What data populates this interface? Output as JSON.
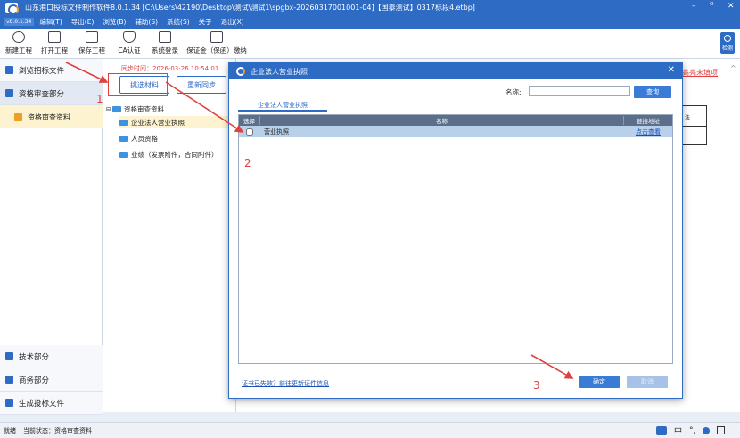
{
  "window": {
    "title": "山东港口投标文件制作软件8.0.1.34    [C:\\Users\\42190\\Desktop\\测试\\测试1\\spgbx-20260317001001-04]【国泰测试】0317标段4.etbp]",
    "controls": [
      "–",
      "ᴼ",
      "✕"
    ]
  },
  "menu": {
    "version_tag": "v8.0.1.34",
    "items": [
      "编辑(T)",
      "导出(E)",
      "浏览(B)",
      "辅助(S)",
      "系统(S)",
      "关于",
      "退出(X)"
    ]
  },
  "toolbar": {
    "buttons": [
      "新建工程",
      "打开工程",
      "保存工程",
      "CA认证",
      "系统登录",
      "保证金（保函）缴纳"
    ],
    "detect_label": "检测"
  },
  "left_nav": {
    "items": [
      "浏览招标文件",
      "资格审查部分"
    ],
    "sub_item": "资格审查资料",
    "bottom_items": [
      "技术部分",
      "商务部分",
      "生成投标文件"
    ]
  },
  "middle": {
    "sync_time_label": "同步时间：2026-03-26 10:54:01",
    "select_button": "挑选材料",
    "resync_button": "重新同步",
    "tree_root": "资格审查资料",
    "tree_children": [
      "企业法人营业执照",
      "人员资格",
      "业绩（发票附件，合同附件）"
    ]
  },
  "background_right": {
    "link_text": "高亮未填项",
    "cell_text": "法"
  },
  "dialog": {
    "title": "企业法人营业执照",
    "close": "✕",
    "search_label": "名称:",
    "search_value": "",
    "search_button": "查询",
    "tab": "企业法人营业执照",
    "columns": [
      "选择",
      "名称",
      "链接地址"
    ],
    "rows": [
      {
        "checked": false,
        "name": "营业执照",
        "link": "点击查看"
      }
    ],
    "footer_link": "证书已失效？前往更新证件信息",
    "confirm_button": "确定",
    "cancel_button": "取消"
  },
  "annotations": {
    "step1": "1",
    "step2": "2",
    "step3": "3",
    "color": "#e04040"
  },
  "status_bar": {
    "ready": "就绪",
    "state_label": "当前状态：",
    "state_value": "资格审查资料"
  },
  "tray": {
    "ime_items": [
      "中",
      "°,"
    ],
    "icons": [
      "keyboard-icon",
      "user-icon",
      "grid-icon"
    ]
  }
}
